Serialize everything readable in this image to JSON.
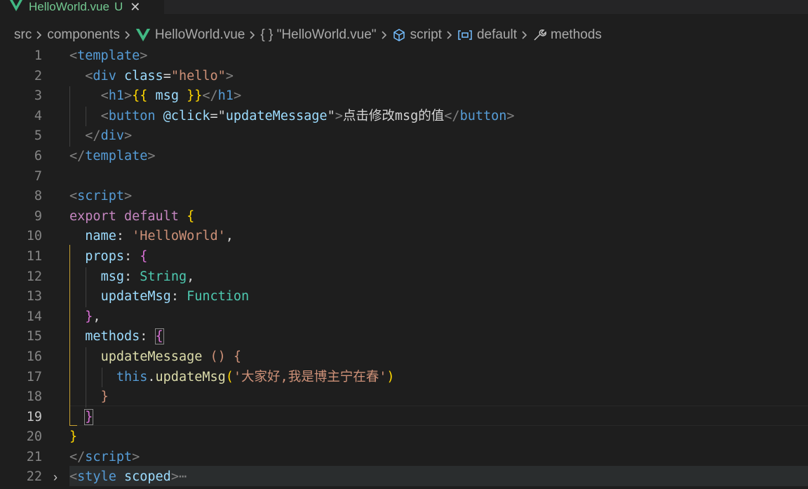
{
  "tab": {
    "filename": "HelloWorld.vue",
    "badge": "U",
    "close_glyph": "✕"
  },
  "breadcrumb": {
    "items": [
      "src",
      "components",
      "HelloWorld.vue",
      "{ } \"HelloWorld.vue\"",
      "script",
      "default",
      "methods"
    ],
    "separator": ">"
  },
  "colors": {
    "vue_green": "#41b883",
    "modified_green": "#73c991",
    "icon_blue": "#75beff",
    "scope_gold": "#c8a232"
  },
  "editor": {
    "active_line": 19,
    "line_numbers": [
      "1",
      "2",
      "3",
      "4",
      "5",
      "6",
      "7",
      "8",
      "9",
      "10",
      "11",
      "12",
      "13",
      "14",
      "15",
      "16",
      "17",
      "18",
      "19",
      "20",
      "21",
      "22"
    ],
    "lines": [
      [
        [
          "tag",
          "<"
        ],
        [
          "tn",
          "template"
        ],
        [
          "tag",
          ">"
        ]
      ],
      [
        [
          "wt",
          "  "
        ],
        [
          "tag",
          "<"
        ],
        [
          "tn",
          "div"
        ],
        [
          "wt",
          " "
        ],
        [
          "at",
          "class"
        ],
        [
          "wt",
          "="
        ],
        [
          "st",
          "\"hello\""
        ],
        [
          "tag",
          ">"
        ]
      ],
      [
        [
          "wt",
          "    "
        ],
        [
          "tag",
          "<"
        ],
        [
          "tn",
          "h1"
        ],
        [
          "tag",
          ">"
        ],
        [
          "br",
          "{{"
        ],
        [
          "wt",
          " "
        ],
        [
          "pr",
          "msg"
        ],
        [
          "wt",
          " "
        ],
        [
          "br",
          "}}"
        ],
        [
          "tag",
          "</"
        ],
        [
          "tn",
          "h1"
        ],
        [
          "tag",
          ">"
        ]
      ],
      [
        [
          "wt",
          "    "
        ],
        [
          "tag",
          "<"
        ],
        [
          "tn",
          "button"
        ],
        [
          "wt",
          " "
        ],
        [
          "at",
          "@click"
        ],
        [
          "wt",
          "="
        ],
        [
          "wt",
          "\""
        ],
        [
          "pr",
          "updateMessage"
        ],
        [
          "wt",
          "\""
        ],
        [
          "tag",
          ">"
        ],
        [
          "wt",
          "点击修改msg的值"
        ],
        [
          "tag",
          "</"
        ],
        [
          "tn",
          "button"
        ],
        [
          "tag",
          ">"
        ]
      ],
      [
        [
          "wt",
          "  "
        ],
        [
          "tag",
          "</"
        ],
        [
          "tn",
          "div"
        ],
        [
          "tag",
          ">"
        ]
      ],
      [
        [
          "tag",
          "</"
        ],
        [
          "tn",
          "template"
        ],
        [
          "tag",
          ">"
        ]
      ],
      [],
      [
        [
          "tag",
          "<"
        ],
        [
          "tn",
          "script"
        ],
        [
          "tag",
          ">"
        ]
      ],
      [
        [
          "kw",
          "export"
        ],
        [
          "wt",
          " "
        ],
        [
          "kw",
          "default"
        ],
        [
          "wt",
          " "
        ],
        [
          "br",
          "{"
        ]
      ],
      [
        [
          "wt",
          "  "
        ],
        [
          "pr",
          "name"
        ],
        [
          "wt",
          ": "
        ],
        [
          "st",
          "'HelloWorld'"
        ],
        [
          "wt",
          ","
        ]
      ],
      [
        [
          "wt",
          "  "
        ],
        [
          "pr",
          "props"
        ],
        [
          "wt",
          ": "
        ],
        [
          "bp",
          "{"
        ]
      ],
      [
        [
          "wt",
          "    "
        ],
        [
          "pr",
          "msg"
        ],
        [
          "wt",
          ": "
        ],
        [
          "ty",
          "String"
        ],
        [
          "wt",
          ","
        ]
      ],
      [
        [
          "wt",
          "    "
        ],
        [
          "pr",
          "updateMsg"
        ],
        [
          "wt",
          ": "
        ],
        [
          "ty",
          "Function"
        ]
      ],
      [
        [
          "wt",
          "  "
        ],
        [
          "bp",
          "}"
        ],
        [
          "wt",
          ","
        ]
      ],
      [
        [
          "wt",
          "  "
        ],
        [
          "pr",
          "methods"
        ],
        [
          "wt",
          ": "
        ],
        [
          "bp",
          "{"
        ]
      ],
      [
        [
          "wt",
          "    "
        ],
        [
          "fn",
          "updateMessage"
        ],
        [
          "wt",
          " "
        ],
        [
          "st",
          "()"
        ],
        [
          "wt",
          " "
        ],
        [
          "st",
          "{"
        ]
      ],
      [
        [
          "wt",
          "      "
        ],
        [
          "tn",
          "this"
        ],
        [
          "wt",
          "."
        ],
        [
          "fn",
          "updateMsg"
        ],
        [
          "br",
          "("
        ],
        [
          "st",
          "'大家好,我是博主宁在春'"
        ],
        [
          "br",
          ")"
        ]
      ],
      [
        [
          "wt",
          "    "
        ],
        [
          "st",
          "}"
        ]
      ],
      [
        [
          "wt",
          "  "
        ],
        [
          "bp",
          "}"
        ]
      ],
      [
        [
          "br",
          "}"
        ]
      ],
      [
        [
          "tag",
          "</"
        ],
        [
          "tn",
          "script"
        ],
        [
          "tag",
          ">"
        ]
      ],
      [
        [
          "tag",
          "<"
        ],
        [
          "tn",
          "style"
        ],
        [
          "wt",
          " "
        ],
        [
          "at",
          "scoped"
        ],
        [
          "tag",
          ">"
        ],
        [
          "tag",
          "⋯"
        ]
      ]
    ]
  }
}
